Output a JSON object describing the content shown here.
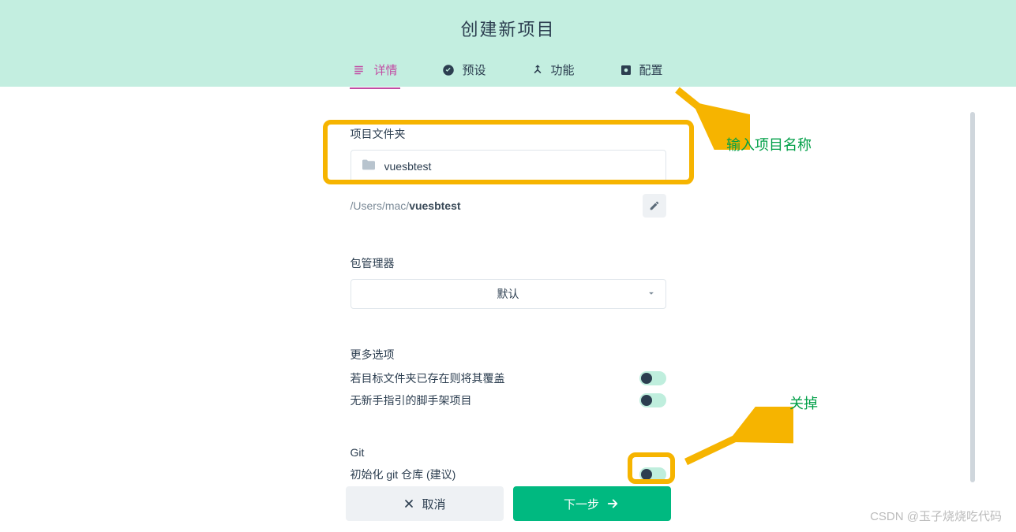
{
  "header": {
    "title": "创建新项目",
    "tabs": [
      {
        "label": "详情",
        "icon": "list-icon",
        "active": true
      },
      {
        "label": "预设",
        "icon": "check-icon",
        "active": false
      },
      {
        "label": "功能",
        "icon": "merge-icon",
        "active": false
      },
      {
        "label": "配置",
        "icon": "settings-icon",
        "active": false
      }
    ]
  },
  "form": {
    "project_folder": {
      "label": "项目文件夹",
      "value": "vuesbtest",
      "path_prefix": "/Users/mac/",
      "path_name": "vuesbtest"
    },
    "package_manager": {
      "label": "包管理器",
      "selected": "默认"
    },
    "more_options": {
      "label": "更多选项",
      "items": [
        {
          "label": "若目标文件夹已存在则将其覆盖",
          "on": false
        },
        {
          "label": "无新手指引的脚手架项目",
          "on": false
        }
      ]
    },
    "git": {
      "label": "Git",
      "item_label": "初始化 git 仓库 (建议)",
      "on": false
    }
  },
  "footer": {
    "cancel": "取消",
    "next": "下一步"
  },
  "annotations": {
    "input_hint": "输入项目名称",
    "toggle_hint": "关掉"
  },
  "watermark": "CSDN @玉子烧烧吃代码",
  "colors": {
    "accent": "#c24ba3",
    "primary": "#00b980",
    "header_bg": "#c3eee0",
    "highlight": "#f6b400",
    "anno_text": "#009f47"
  }
}
